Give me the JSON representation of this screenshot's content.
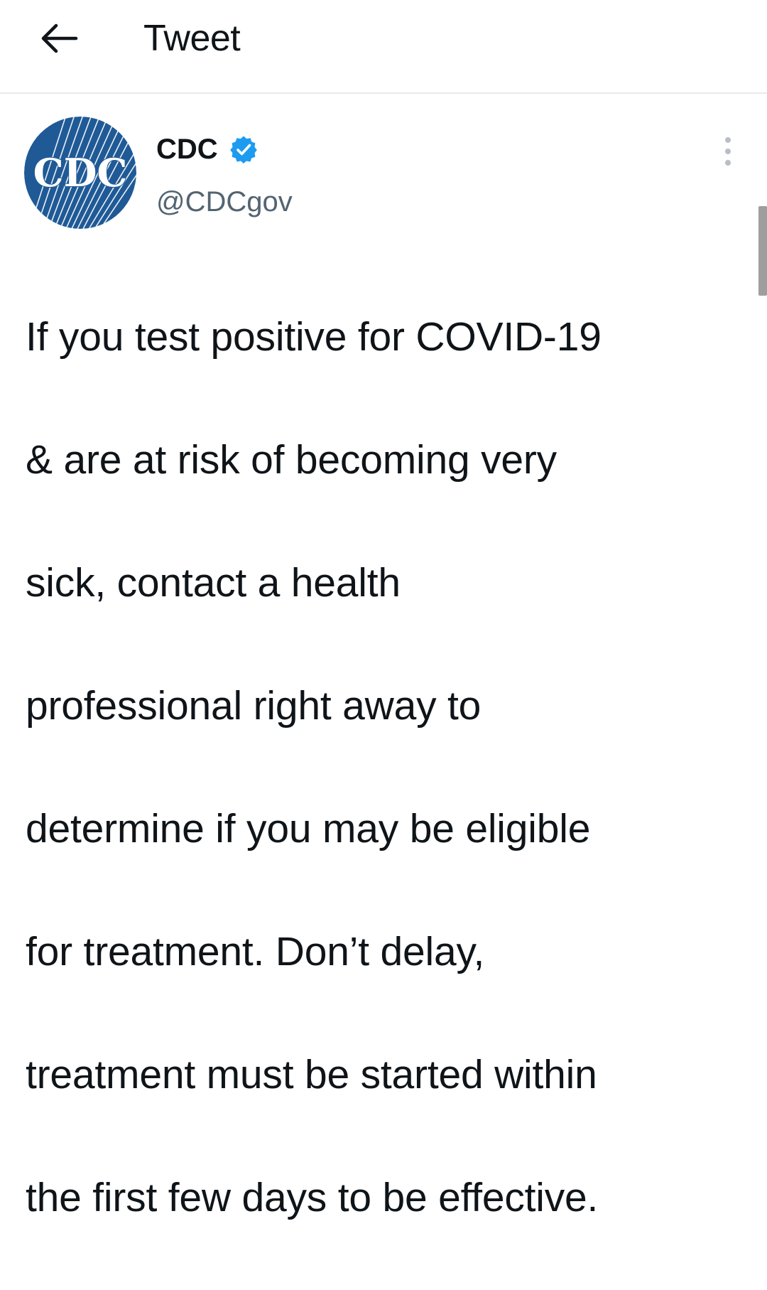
{
  "header": {
    "title": "Tweet",
    "back_icon": "arrow-left-icon"
  },
  "tweet": {
    "author": {
      "display_name": "CDC",
      "handle": "@CDCgov",
      "verified": true,
      "avatar_label": "CDC",
      "avatar_color": "#1f5a96"
    },
    "text_lines": [
      "If you test positive for COVID-19",
      "& are at risk of becoming very",
      "sick, contact a health",
      "professional right away to",
      "determine if you may be eligible",
      "for treatment. Don’t delay,",
      "treatment must be started within",
      "the first few days to be effective."
    ],
    "more_icon": "more-vertical-icon",
    "verified_icon": "verified-badge-icon"
  },
  "colors": {
    "text_primary": "#0f1419",
    "text_secondary": "#536471",
    "accent": "#1d9bf0",
    "divider": "#e7e9ea"
  }
}
